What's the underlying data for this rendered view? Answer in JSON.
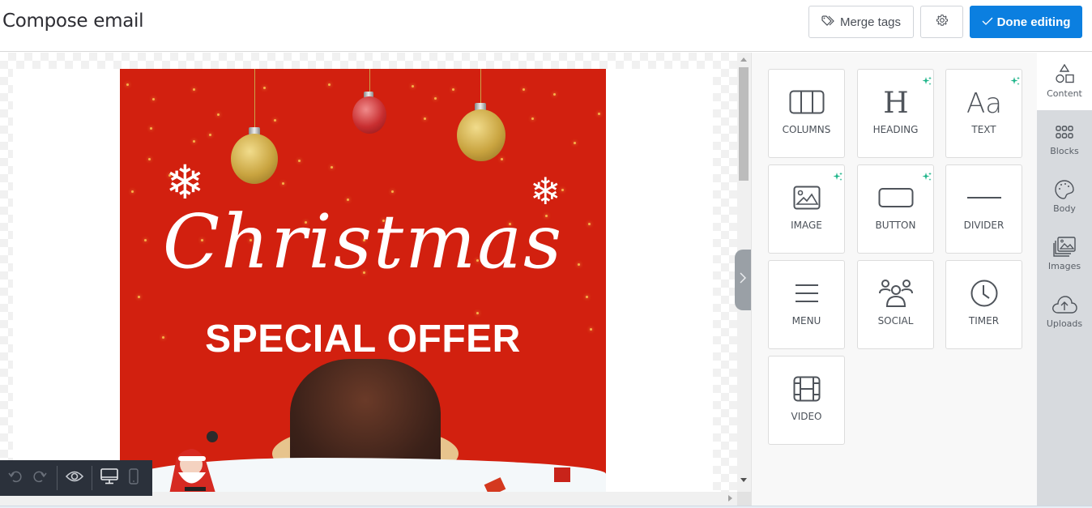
{
  "header": {
    "title": "Compose email",
    "merge_tags_label": "Merge tags",
    "done_editing_label": "Done editing",
    "accent_color": "#0b7fe0"
  },
  "email": {
    "script_title": "Christmas",
    "subtitle": "SPECIAL OFFER",
    "background_color": "#d2200f"
  },
  "toolbar": {
    "items": [
      "undo-icon",
      "redo-icon",
      "preview-eye-icon",
      "desktop-icon",
      "mobile-icon"
    ]
  },
  "content_tiles": [
    {
      "label": "COLUMNS",
      "icon": "columns-icon",
      "ai": false
    },
    {
      "label": "HEADING",
      "icon": "heading-icon",
      "ai": true
    },
    {
      "label": "TEXT",
      "icon": "text-icon",
      "ai": true
    },
    {
      "label": "IMAGE",
      "icon": "image-icon",
      "ai": true
    },
    {
      "label": "BUTTON",
      "icon": "button-icon",
      "ai": true
    },
    {
      "label": "DIVIDER",
      "icon": "divider-icon",
      "ai": false
    },
    {
      "label": "MENU",
      "icon": "menu-icon",
      "ai": false
    },
    {
      "label": "SOCIAL",
      "icon": "social-icon",
      "ai": false
    },
    {
      "label": "TIMER",
      "icon": "timer-icon",
      "ai": false
    },
    {
      "label": "VIDEO",
      "icon": "video-icon",
      "ai": false
    }
  ],
  "side_tabs": [
    {
      "label": "Content",
      "icon": "shapes-icon",
      "active": true
    },
    {
      "label": "Blocks",
      "icon": "blocks-grid-icon",
      "active": false
    },
    {
      "label": "Body",
      "icon": "palette-icon",
      "active": false
    },
    {
      "label": "Images",
      "icon": "images-icon",
      "active": false
    },
    {
      "label": "Uploads",
      "icon": "cloud-upload-icon",
      "active": false
    }
  ],
  "ai_sparkle_color": "#1fb58a"
}
